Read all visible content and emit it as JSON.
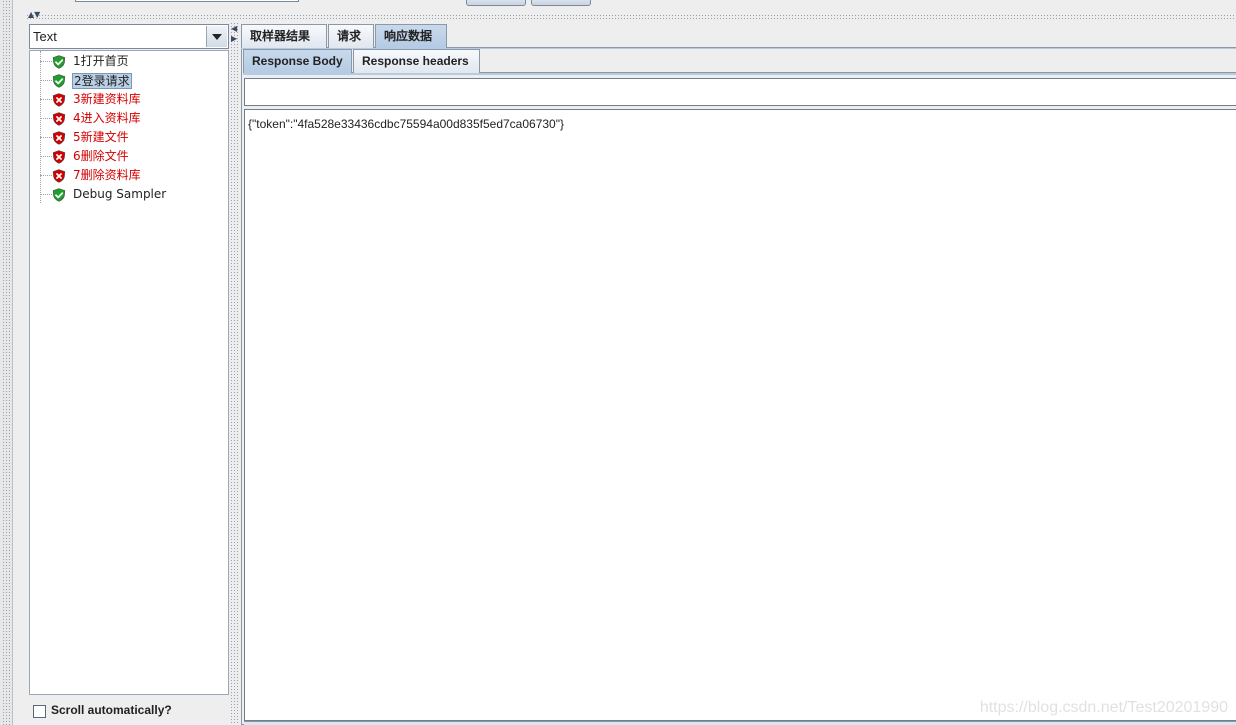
{
  "renderer": {
    "selected": "Text"
  },
  "tree": {
    "items": [
      {
        "label": "1打开首页",
        "status": "success",
        "selected": false
      },
      {
        "label": "2登录请求",
        "status": "success",
        "selected": true
      },
      {
        "label": "3新建资料库",
        "status": "failure",
        "selected": false
      },
      {
        "label": "4进入资料库",
        "status": "failure",
        "selected": false
      },
      {
        "label": "5新建文件",
        "status": "failure",
        "selected": false
      },
      {
        "label": "6删除文件",
        "status": "failure",
        "selected": false
      },
      {
        "label": "7删除资料库",
        "status": "failure",
        "selected": false
      },
      {
        "label": "Debug Sampler",
        "status": "success",
        "selected": false
      }
    ]
  },
  "scroll_auto": {
    "label": "Scroll automatically?",
    "checked": false
  },
  "tabs": {
    "main": [
      {
        "label": "取样器结果",
        "active": false
      },
      {
        "label": "请求",
        "active": false
      },
      {
        "label": "响应数据",
        "active": true
      }
    ],
    "sub": [
      {
        "label": "Response Body",
        "active": true
      },
      {
        "label": "Response headers",
        "active": false
      }
    ]
  },
  "search": {
    "value": ""
  },
  "response_body": {
    "text": "{\"token\":\"4fa528e33436cdbc75594a00d835f5ed7ca06730\"}"
  },
  "watermark": "https://blog.csdn.net/Test20201990",
  "colors": {
    "failure": "#d40000",
    "success": "#1e9e2a",
    "selection": "#b8cfe5"
  },
  "icons": {
    "success": "shield-check-icon",
    "failure": "shield-x-icon"
  }
}
